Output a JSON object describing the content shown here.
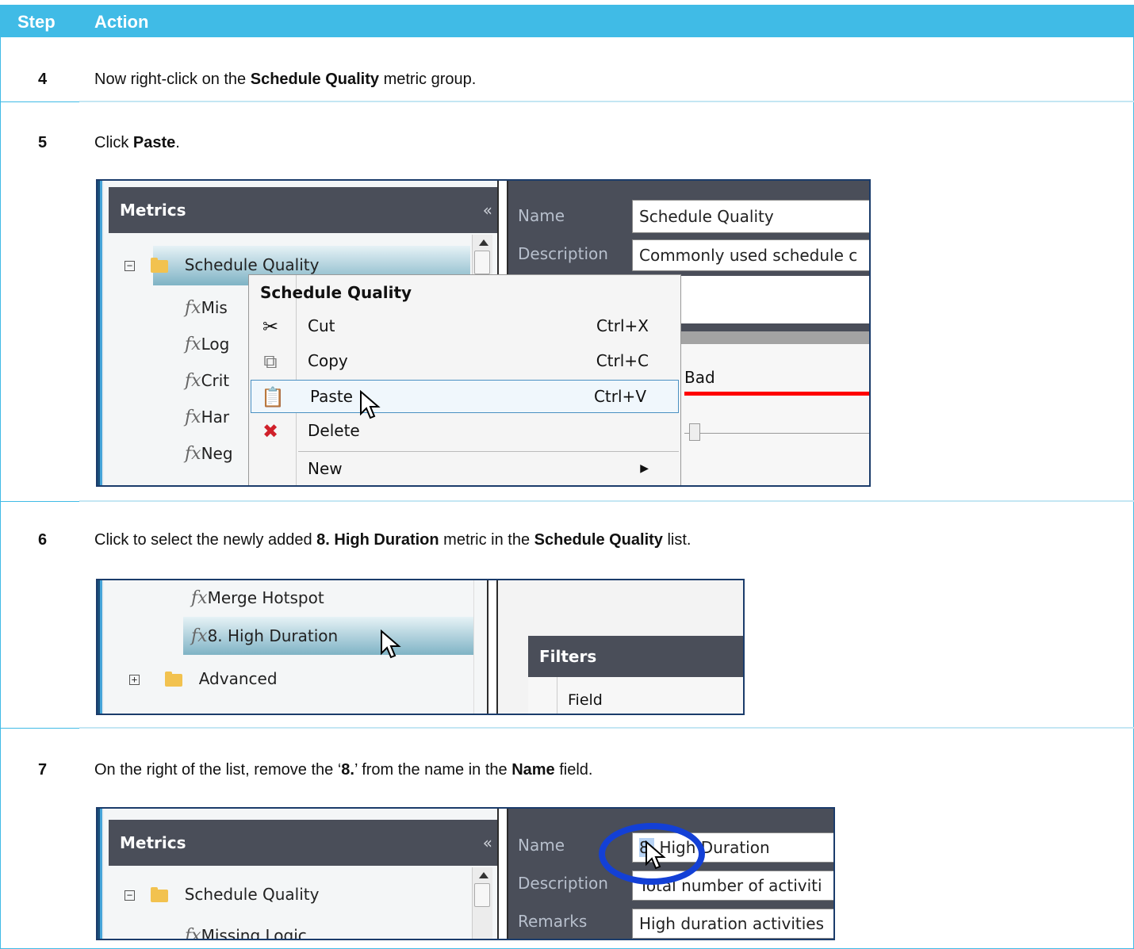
{
  "table": {
    "col_step": "Step",
    "col_action": "Action"
  },
  "steps": [
    {
      "num": "4",
      "pre": "Now right-click on the ",
      "b1": "Schedule Quality",
      "post": " metric group."
    },
    {
      "num": "5",
      "pre": "Click ",
      "b1": "Paste",
      "post": "."
    },
    {
      "num": "6",
      "pre": "Click to select the newly added ",
      "b1": "8. High Duration",
      "mid": " metric in the ",
      "b2": "Schedule Quality",
      "post": " list."
    },
    {
      "num": "7",
      "pre": "On the right of the list, remove the ‘",
      "b1": "8.",
      "mid": "’ from the name in the ",
      "b2": "Name",
      "post": " field."
    }
  ],
  "shot1": {
    "panel_title": "Metrics",
    "collapse_icon": "«",
    "folder_label": "Schedule Quality",
    "fx_items": [
      "Mis",
      "Log",
      "Crit",
      "Har",
      "Neg"
    ],
    "name_label": "Name",
    "name_value": "Schedule Quality",
    "desc_label": "Description",
    "desc_value": "Commonly used schedule c",
    "bad_label": "Bad",
    "menu": {
      "title": "Schedule Quality",
      "items": [
        {
          "label": "Cut",
          "shortcut": "Ctrl+X",
          "icon": "scissors-icon"
        },
        {
          "label": "Copy",
          "shortcut": "Ctrl+C",
          "icon": "copy-icon"
        },
        {
          "label": "Paste",
          "shortcut": "Ctrl+V",
          "icon": "paste-icon"
        },
        {
          "label": "Delete",
          "shortcut": "",
          "icon": "delete-icon"
        },
        {
          "label": "New",
          "shortcut": "",
          "icon": ""
        }
      ]
    }
  },
  "shot2": {
    "item1": "Merge Hotspot",
    "item2": "8. High Duration",
    "folder_label": "Advanced",
    "filters_title": "Filters",
    "field_header": "Field"
  },
  "shot3": {
    "panel_title": "Metrics",
    "collapse_icon": "«",
    "folder_label": "Schedule Quality",
    "partial_item": "Missing Logic",
    "name_label": "Name",
    "name_sel": "8.",
    "name_rest": " High Duration",
    "desc_label": "Description",
    "desc_value": "Total number of activiti",
    "remarks_label": "Remarks",
    "remarks_value": "High duration activities"
  },
  "colors": {
    "header": "#40bbe6",
    "nav_header": "#4a4e59",
    "circle": "#1340d6"
  }
}
